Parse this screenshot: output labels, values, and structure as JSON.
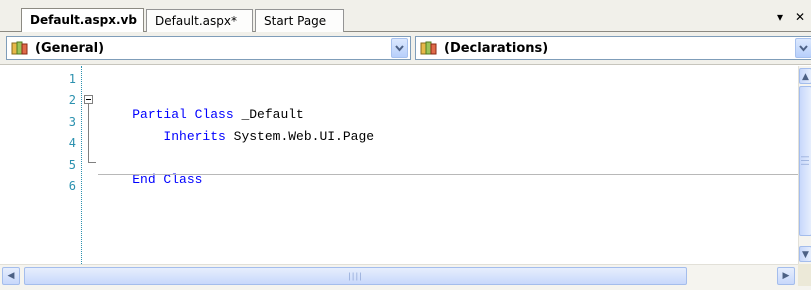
{
  "tabs": [
    {
      "label": "Default.aspx.vb",
      "active": true
    },
    {
      "label": "Default.aspx*",
      "active": false
    },
    {
      "label": "Start Page",
      "active": false
    }
  ],
  "tabstrip": {
    "dropdown_glyph": "▾",
    "close_glyph": "✕"
  },
  "combo_left": {
    "value": "(General)",
    "icon": "class-icon"
  },
  "combo_right": {
    "value": "(Declarations)",
    "icon": "declarations-icon"
  },
  "code": {
    "lines": [
      {
        "number": "1",
        "parts": []
      },
      {
        "number": "2",
        "parts": [
          {
            "text": "Partial Class",
            "kind": "keyword"
          },
          {
            "text": " _Default",
            "kind": "plain"
          }
        ]
      },
      {
        "number": "3",
        "parts": [
          {
            "text": "    Inherits",
            "kind": "keyword"
          },
          {
            "text": " System.Web.UI.Page",
            "kind": "plain"
          }
        ]
      },
      {
        "number": "4",
        "parts": []
      },
      {
        "number": "5",
        "parts": [
          {
            "text": "End Class",
            "kind": "keyword"
          }
        ]
      },
      {
        "number": "6",
        "parts": []
      }
    ]
  },
  "colors": {
    "keyword": "#0000ff",
    "line_number": "#2b91af",
    "plain": "#000000"
  }
}
